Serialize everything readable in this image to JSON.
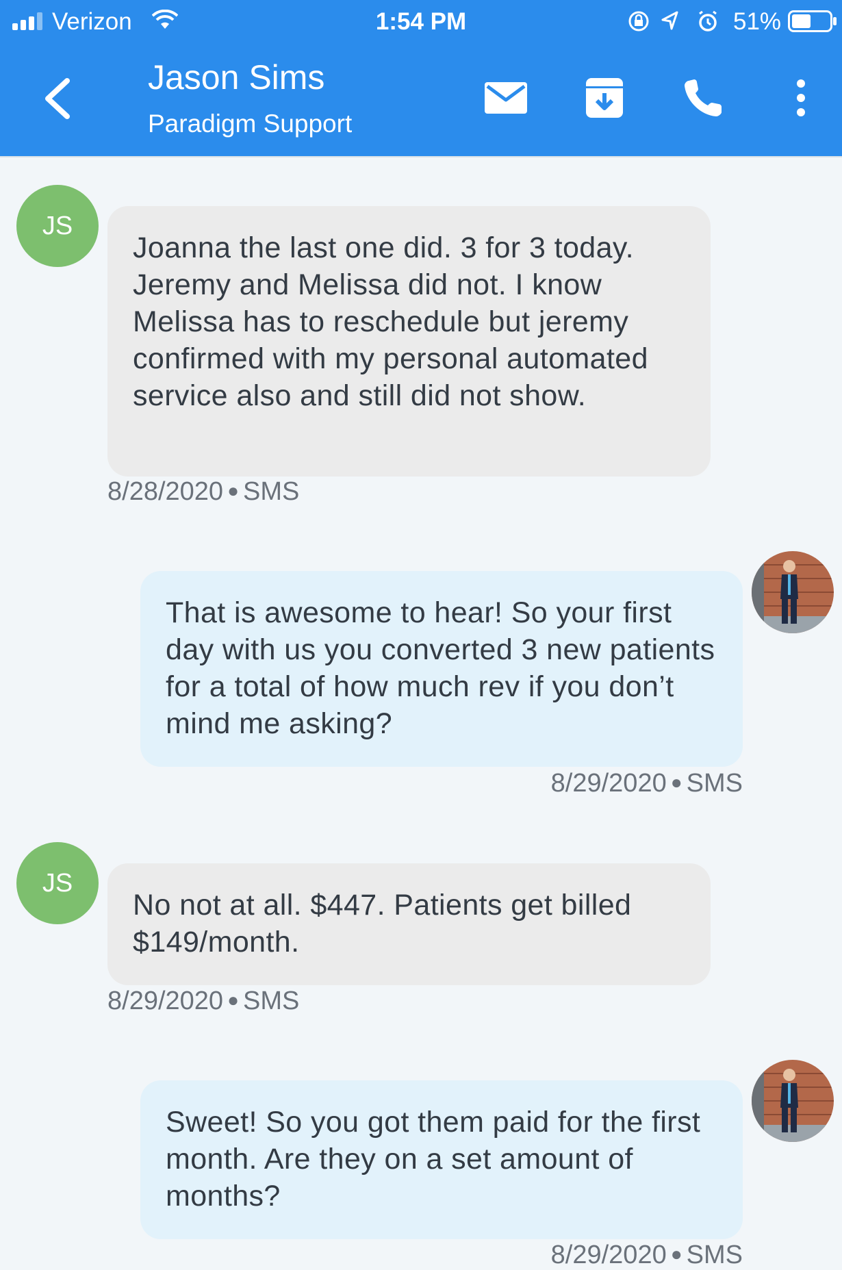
{
  "status_bar": {
    "carrier": "Verizon",
    "time": "1:54 PM",
    "battery_percent": "51%",
    "battery_level": 0.51,
    "icons": [
      "signal-icon",
      "wifi-icon",
      "orientation-lock-icon",
      "location-icon",
      "alarm-icon",
      "battery-icon"
    ]
  },
  "header": {
    "contact_name": "Jason Sims",
    "contact_org": "Paradigm Support",
    "actions": [
      "mail-icon",
      "archive-icon",
      "phone-icon",
      "more-icon"
    ],
    "background_color": "#2b8cec"
  },
  "messages": [
    {
      "direction": "incoming",
      "avatar_initials": "JS",
      "text": "Joanna the last one did. 3 for 3 today. Jeremy and Melissa did not. I know Melissa has to reschedule but jeremy confirmed with my personal automated service also and still did not show.",
      "date": "8/28/2020",
      "channel": "SMS"
    },
    {
      "direction": "outgoing",
      "text": "That is awesome to hear! So your first day with us you converted 3 new patients for a total of how much rev if you don’t mind me asking?",
      "date": "8/29/2020",
      "channel": "SMS"
    },
    {
      "direction": "incoming",
      "avatar_initials": "JS",
      "text": "No not at all. $447. Patients get billed $149/month.",
      "date": "8/29/2020",
      "channel": "SMS"
    },
    {
      "direction": "outgoing",
      "text": "Sweet! So you got them paid for the first month. Are they on a set amount of months?",
      "date": "8/29/2020",
      "channel": "SMS"
    }
  ],
  "colors": {
    "incoming_bubble": "#ebebeb",
    "outgoing_bubble": "#e2f2fb",
    "avatar_green": "#7dbf6e"
  }
}
